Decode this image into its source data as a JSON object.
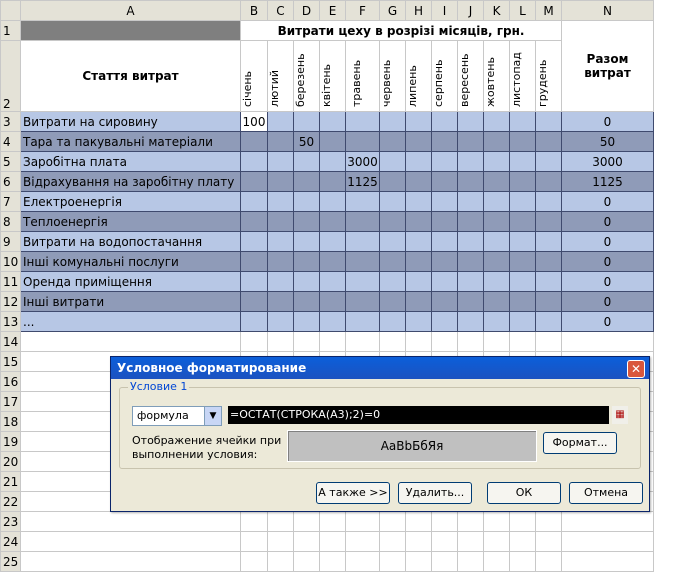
{
  "columns": [
    "A",
    "B",
    "C",
    "D",
    "E",
    "F",
    "G",
    "H",
    "I",
    "J",
    "K",
    "L",
    "M",
    "N"
  ],
  "row_numbers": [
    "1",
    "2",
    "3",
    "4",
    "5",
    "6",
    "7",
    "8",
    "9",
    "10",
    "11",
    "12",
    "13",
    "14",
    "15",
    "16",
    "17",
    "18",
    "19",
    "20",
    "21",
    "22",
    "23",
    "24",
    "25"
  ],
  "sheet": {
    "header_title": "Витрати цеху в розрізі місяців, грн.",
    "item_header": "Стаття витрат",
    "total_header": "Разом витрат",
    "months": [
      "січень",
      "лютий",
      "березень",
      "квітень",
      "травень",
      "червень",
      "липень",
      "серпень",
      "вересень",
      "жовтень",
      "листопад",
      "грудень"
    ],
    "rows": [
      {
        "name": "Витрати на сировину",
        "B": "100",
        "D": "",
        "F": "",
        "total": "0"
      },
      {
        "name": "Тара та пакувальні матеріали",
        "B": "",
        "D": "50",
        "F": "",
        "total": "50"
      },
      {
        "name": "Заробітна плата",
        "B": "",
        "D": "",
        "F": "3000",
        "total": "3000"
      },
      {
        "name": "Відрахування на заробітну плату",
        "B": "",
        "D": "",
        "F": "1125",
        "total": "1125"
      },
      {
        "name": "Електроенергія",
        "B": "",
        "D": "",
        "F": "",
        "total": "0"
      },
      {
        "name": "Теплоенергія",
        "B": "",
        "D": "",
        "F": "",
        "total": "0"
      },
      {
        "name": "Витрати на водопостачання",
        "B": "",
        "D": "",
        "F": "",
        "total": "0"
      },
      {
        "name": "Інші комунальні послуги",
        "B": "",
        "D": "",
        "F": "",
        "total": "0"
      },
      {
        "name": "Оренда приміщення",
        "B": "",
        "D": "",
        "F": "",
        "total": "0"
      },
      {
        "name": "Інші витрати",
        "B": "",
        "D": "",
        "F": "",
        "total": "0"
      },
      {
        "name": "...",
        "B": "",
        "D": "",
        "F": "",
        "total": "0"
      }
    ]
  },
  "dialog": {
    "title": "Условное форматирование",
    "close_label": "✕",
    "condition_label": "Условие 1",
    "type_value": "формула",
    "formula_value": "=ОСТАТ(СТРОКА(A3);2)=0",
    "display_label": "Отображение ячейки при выполнении условия:",
    "preview_text": "АаВbБбЯя",
    "format_button": "Формат...",
    "also_button": "А также >>",
    "delete_button": "Удалить...",
    "ok_button": "ОК",
    "cancel_button": "Отмена"
  }
}
